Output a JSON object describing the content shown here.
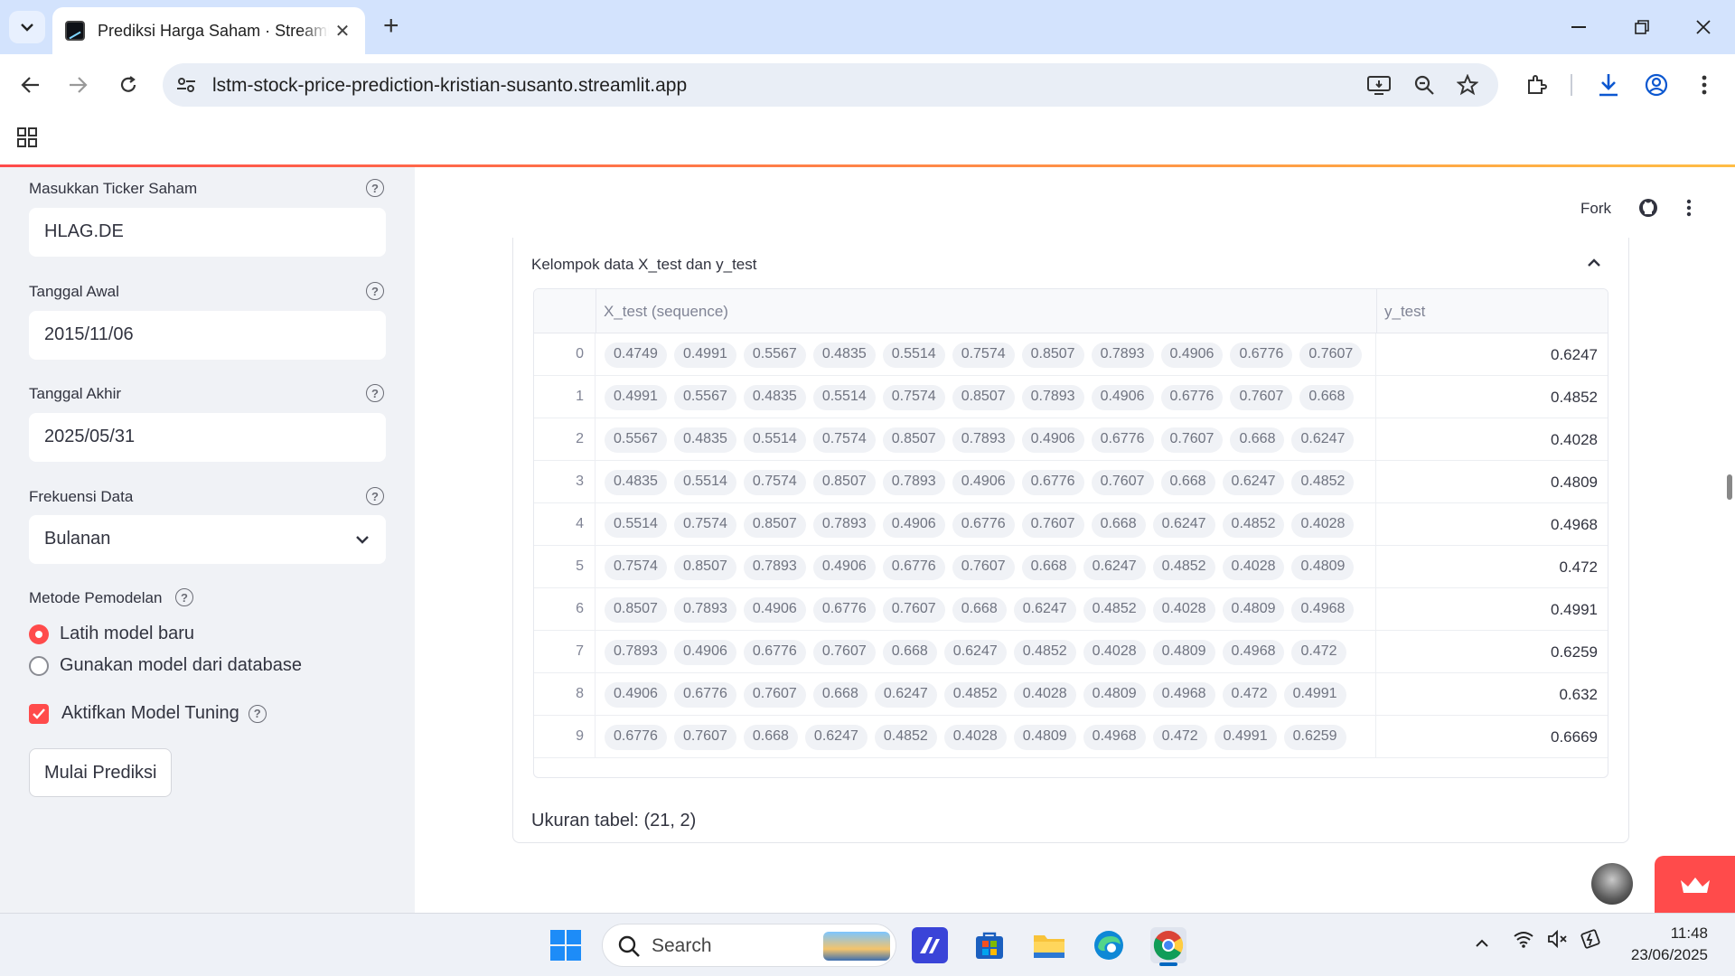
{
  "browser": {
    "tab_title": "Prediksi Harga Saham · Streamlit",
    "url": "lstm-stock-price-prediction-kristian-susanto.streamlit.app"
  },
  "sidebar": {
    "ticker_label": "Masukkan Ticker Saham",
    "ticker_value": "HLAG.DE",
    "start_label": "Tanggal Awal",
    "start_value": "2015/11/06",
    "end_label": "Tanggal Akhir",
    "end_value": "2025/05/31",
    "freq_label": "Frekuensi Data",
    "freq_value": "Bulanan",
    "method_label": "Metode Pemodelan",
    "method_options": [
      "Latih model baru",
      "Gunakan model dari database"
    ],
    "method_selected": 0,
    "tuning_label": "Aktifkan Model Tuning",
    "tuning_checked": true,
    "predict_button": "Mulai Prediksi"
  },
  "main": {
    "fork_label": "Fork",
    "expander_title": "Kelompok data X_test dan y_test",
    "columns": [
      "X_test (sequence)",
      "y_test"
    ],
    "rows": [
      {
        "index": "0",
        "seq": [
          "0.4749",
          "0.4991",
          "0.5567",
          "0.4835",
          "0.5514",
          "0.7574",
          "0.8507",
          "0.7893",
          "0.4906",
          "0.6776",
          "0.7607"
        ],
        "y": "0.6247"
      },
      {
        "index": "1",
        "seq": [
          "0.4991",
          "0.5567",
          "0.4835",
          "0.5514",
          "0.7574",
          "0.8507",
          "0.7893",
          "0.4906",
          "0.6776",
          "0.7607",
          "0.668"
        ],
        "y": "0.4852"
      },
      {
        "index": "2",
        "seq": [
          "0.5567",
          "0.4835",
          "0.5514",
          "0.7574",
          "0.8507",
          "0.7893",
          "0.4906",
          "0.6776",
          "0.7607",
          "0.668",
          "0.6247"
        ],
        "y": "0.4028"
      },
      {
        "index": "3",
        "seq": [
          "0.4835",
          "0.5514",
          "0.7574",
          "0.8507",
          "0.7893",
          "0.4906",
          "0.6776",
          "0.7607",
          "0.668",
          "0.6247",
          "0.4852"
        ],
        "y": "0.4809"
      },
      {
        "index": "4",
        "seq": [
          "0.5514",
          "0.7574",
          "0.8507",
          "0.7893",
          "0.4906",
          "0.6776",
          "0.7607",
          "0.668",
          "0.6247",
          "0.4852",
          "0.4028"
        ],
        "y": "0.4968"
      },
      {
        "index": "5",
        "seq": [
          "0.7574",
          "0.8507",
          "0.7893",
          "0.4906",
          "0.6776",
          "0.7607",
          "0.668",
          "0.6247",
          "0.4852",
          "0.4028",
          "0.4809"
        ],
        "y": "0.472"
      },
      {
        "index": "6",
        "seq": [
          "0.8507",
          "0.7893",
          "0.4906",
          "0.6776",
          "0.7607",
          "0.668",
          "0.6247",
          "0.4852",
          "0.4028",
          "0.4809",
          "0.4968"
        ],
        "y": "0.4991"
      },
      {
        "index": "7",
        "seq": [
          "0.7893",
          "0.4906",
          "0.6776",
          "0.7607",
          "0.668",
          "0.6247",
          "0.4852",
          "0.4028",
          "0.4809",
          "0.4968",
          "0.472"
        ],
        "y": "0.6259"
      },
      {
        "index": "8",
        "seq": [
          "0.4906",
          "0.6776",
          "0.7607",
          "0.668",
          "0.6247",
          "0.4852",
          "0.4028",
          "0.4809",
          "0.4968",
          "0.472",
          "0.4991"
        ],
        "y": "0.632"
      },
      {
        "index": "9",
        "seq": [
          "0.6776",
          "0.7607",
          "0.668",
          "0.6247",
          "0.4852",
          "0.4028",
          "0.4809",
          "0.4968",
          "0.472",
          "0.4991",
          "0.6259"
        ],
        "y": "0.6669"
      }
    ],
    "table_size": "Ukuran tabel: (21, 2)"
  },
  "taskbar": {
    "search_label": "Search",
    "time": "11:48",
    "date": "23/06/2025"
  },
  "colors": {
    "accent": "#ff4b4b",
    "sidebar_bg": "#f0f2f6",
    "chrome_bg": "#d3e3fd"
  }
}
